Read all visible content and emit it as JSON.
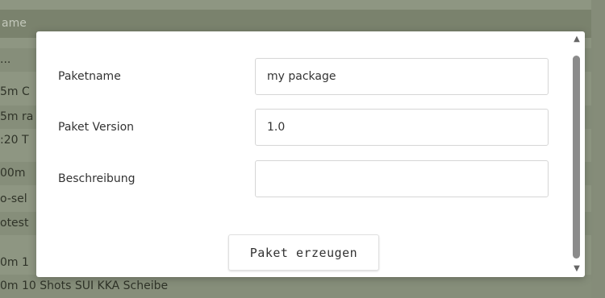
{
  "background": {
    "header": "ame",
    "rows": [
      {
        "text": "...",
        "style": "alt"
      },
      {
        "text": "5m C",
        "style": ""
      },
      {
        "text": "5m ra",
        "style": "alt"
      },
      {
        "text": ":20 T",
        "style": ""
      },
      {
        "text": "00m",
        "style": "alt"
      },
      {
        "text": "o-sel",
        "style": ""
      },
      {
        "text": "otest",
        "style": "alt"
      },
      {
        "text": "0m 1",
        "style": ""
      },
      {
        "text": "0m 10 Shots SUI KKA Scheibe",
        "style": "alt"
      }
    ]
  },
  "dialog": {
    "fields": [
      {
        "label": "Paketname",
        "value": "my package"
      },
      {
        "label": "Paket Version",
        "value": "1.0"
      },
      {
        "label": "Beschreibung",
        "value": ""
      }
    ],
    "submit_label": "Paket erzeugen"
  },
  "scrollbar": {
    "up_icon": "▲",
    "down_icon": "▼"
  }
}
